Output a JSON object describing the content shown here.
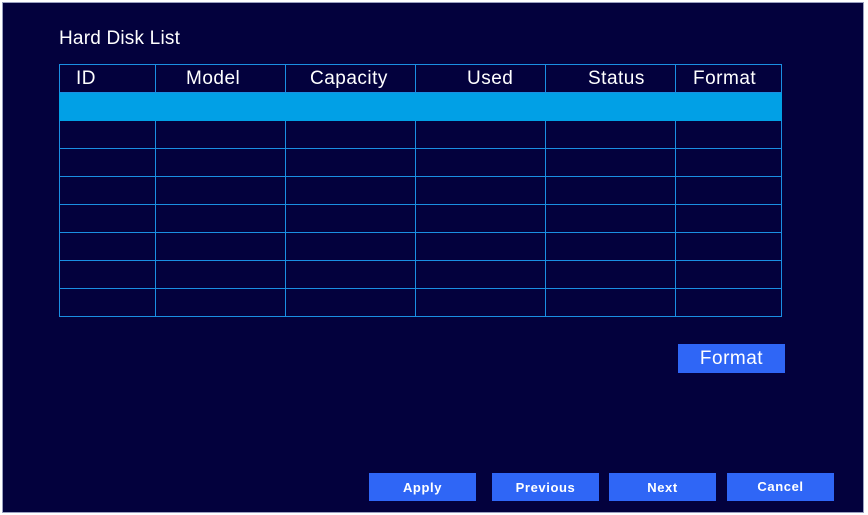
{
  "panel": {
    "title": "Hard Disk List"
  },
  "table": {
    "columns": [
      "ID",
      "Model",
      "Capacity",
      "Used",
      "Status",
      "Format"
    ],
    "rows": [
      [
        "",
        "",
        "",
        "",
        "",
        ""
      ],
      [
        "",
        "",
        "",
        "",
        "",
        ""
      ],
      [
        "",
        "",
        "",
        "",
        "",
        ""
      ],
      [
        "",
        "",
        "",
        "",
        "",
        ""
      ],
      [
        "",
        "",
        "",
        "",
        "",
        ""
      ],
      [
        "",
        "",
        "",
        "",
        "",
        ""
      ],
      [
        "",
        "",
        "",
        "",
        "",
        ""
      ],
      [
        "",
        "",
        "",
        "",
        "",
        ""
      ]
    ],
    "selected_row_index": 0
  },
  "actions": {
    "format_label": "Format"
  },
  "footer": {
    "apply_label": "Apply",
    "previous_label": "Previous",
    "next_label": "Next",
    "cancel_label": "Cancel"
  },
  "colors": {
    "background": "#03013d",
    "grid_line": "#1a8fe3",
    "selected_row": "#01a0e6",
    "button": "#2f66f6",
    "text": "#ffffff"
  }
}
